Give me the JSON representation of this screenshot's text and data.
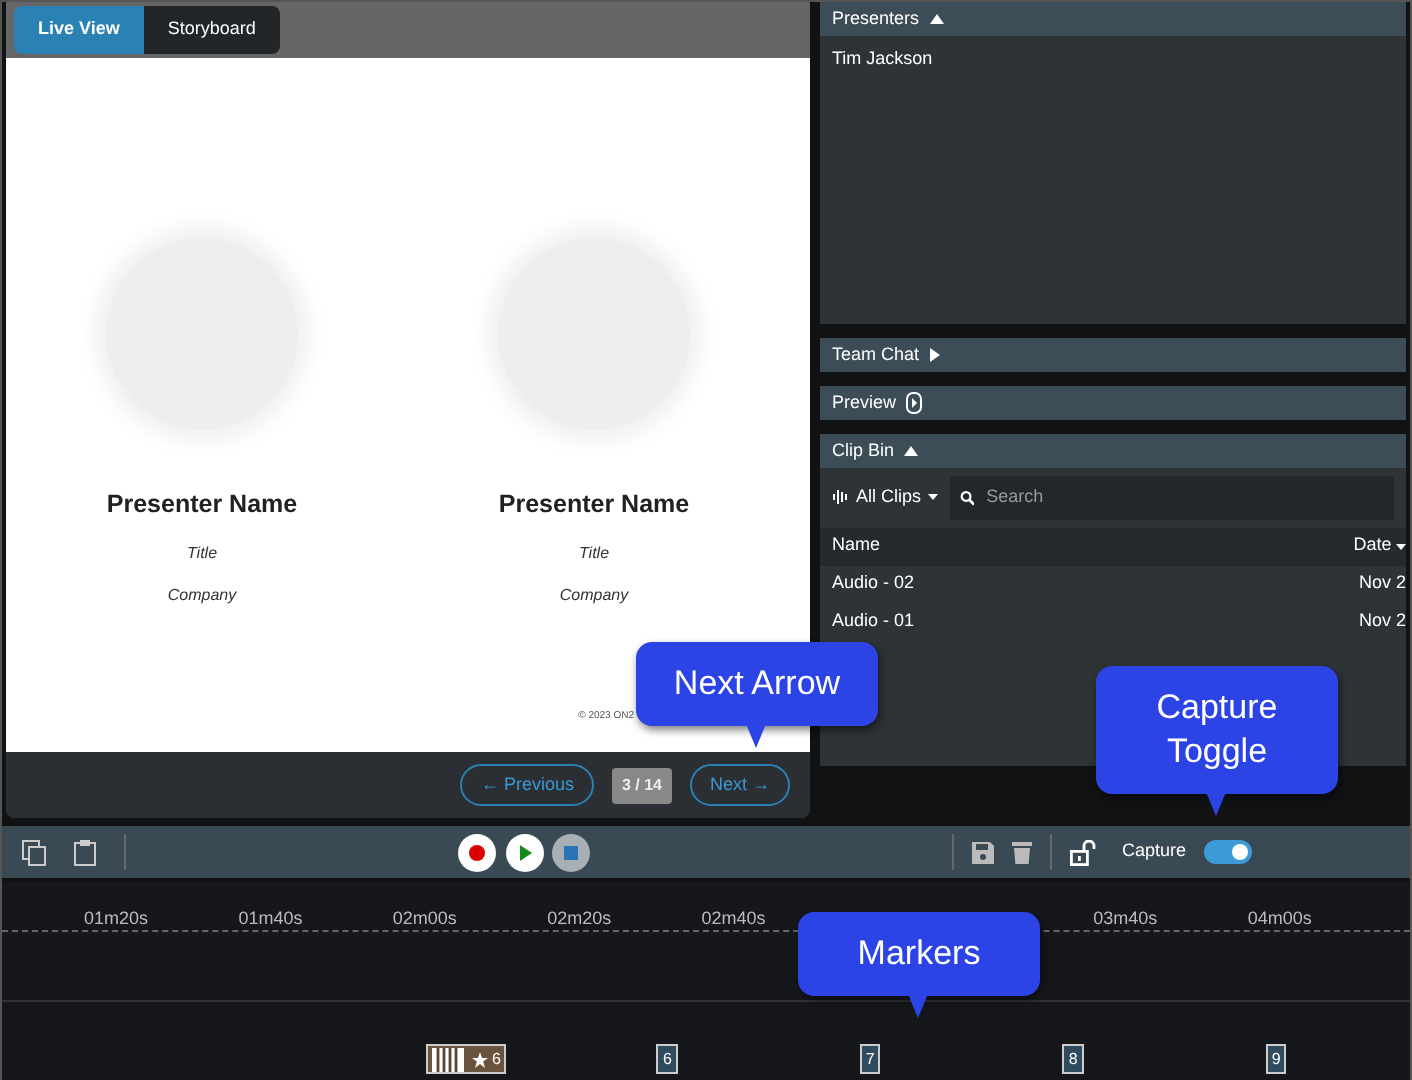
{
  "tabs": [
    {
      "label": "Live View",
      "selected": true
    },
    {
      "label": "Storyboard",
      "selected": false
    }
  ],
  "slide": {
    "presenters": [
      {
        "name": "Presenter Name",
        "title": "Title",
        "company": "Company"
      },
      {
        "name": "Presenter Name",
        "title": "Title",
        "company": "Company"
      }
    ],
    "copyright": "© 2023 ON2"
  },
  "pager": {
    "previous": "← Previous",
    "page": "3 / 14",
    "next": "Next →"
  },
  "panels": [
    {
      "kind": "presenters",
      "title": "Presenters",
      "expanded": true,
      "items": [
        "Tim Jackson"
      ]
    },
    {
      "kind": "chat",
      "title": "Team Chat",
      "expanded": false
    },
    {
      "kind": "preview",
      "title": "Preview"
    },
    {
      "kind": "clips",
      "title": "Clip Bin",
      "expanded": true,
      "filter": "All Clips",
      "search_placeholder": "Search",
      "columns": [
        "Name",
        "Date"
      ],
      "rows": [
        [
          "Audio - 02",
          "Nov 2"
        ],
        [
          "Audio - 01",
          "Nov 2"
        ]
      ]
    }
  ],
  "toolbar": {
    "capture_label": "Capture",
    "capture_on": true
  },
  "timeline": {
    "ruler_left": [
      "01m20s",
      "01m40s",
      "02m00s",
      "02m20s",
      "02m40s"
    ],
    "ruler_right": [
      "03m40s",
      "04m00s"
    ],
    "markers": [
      {
        "kind": "star",
        "label": "6"
      },
      {
        "kind": "plain",
        "label": "6"
      },
      {
        "kind": "plain",
        "label": "7"
      },
      {
        "kind": "plain",
        "label": "8"
      },
      {
        "kind": "plain",
        "label": "9"
      }
    ]
  },
  "callouts": [
    {
      "text": "Next Arrow"
    },
    {
      "text": "Capture Toggle"
    },
    {
      "text": "Markers"
    }
  ]
}
